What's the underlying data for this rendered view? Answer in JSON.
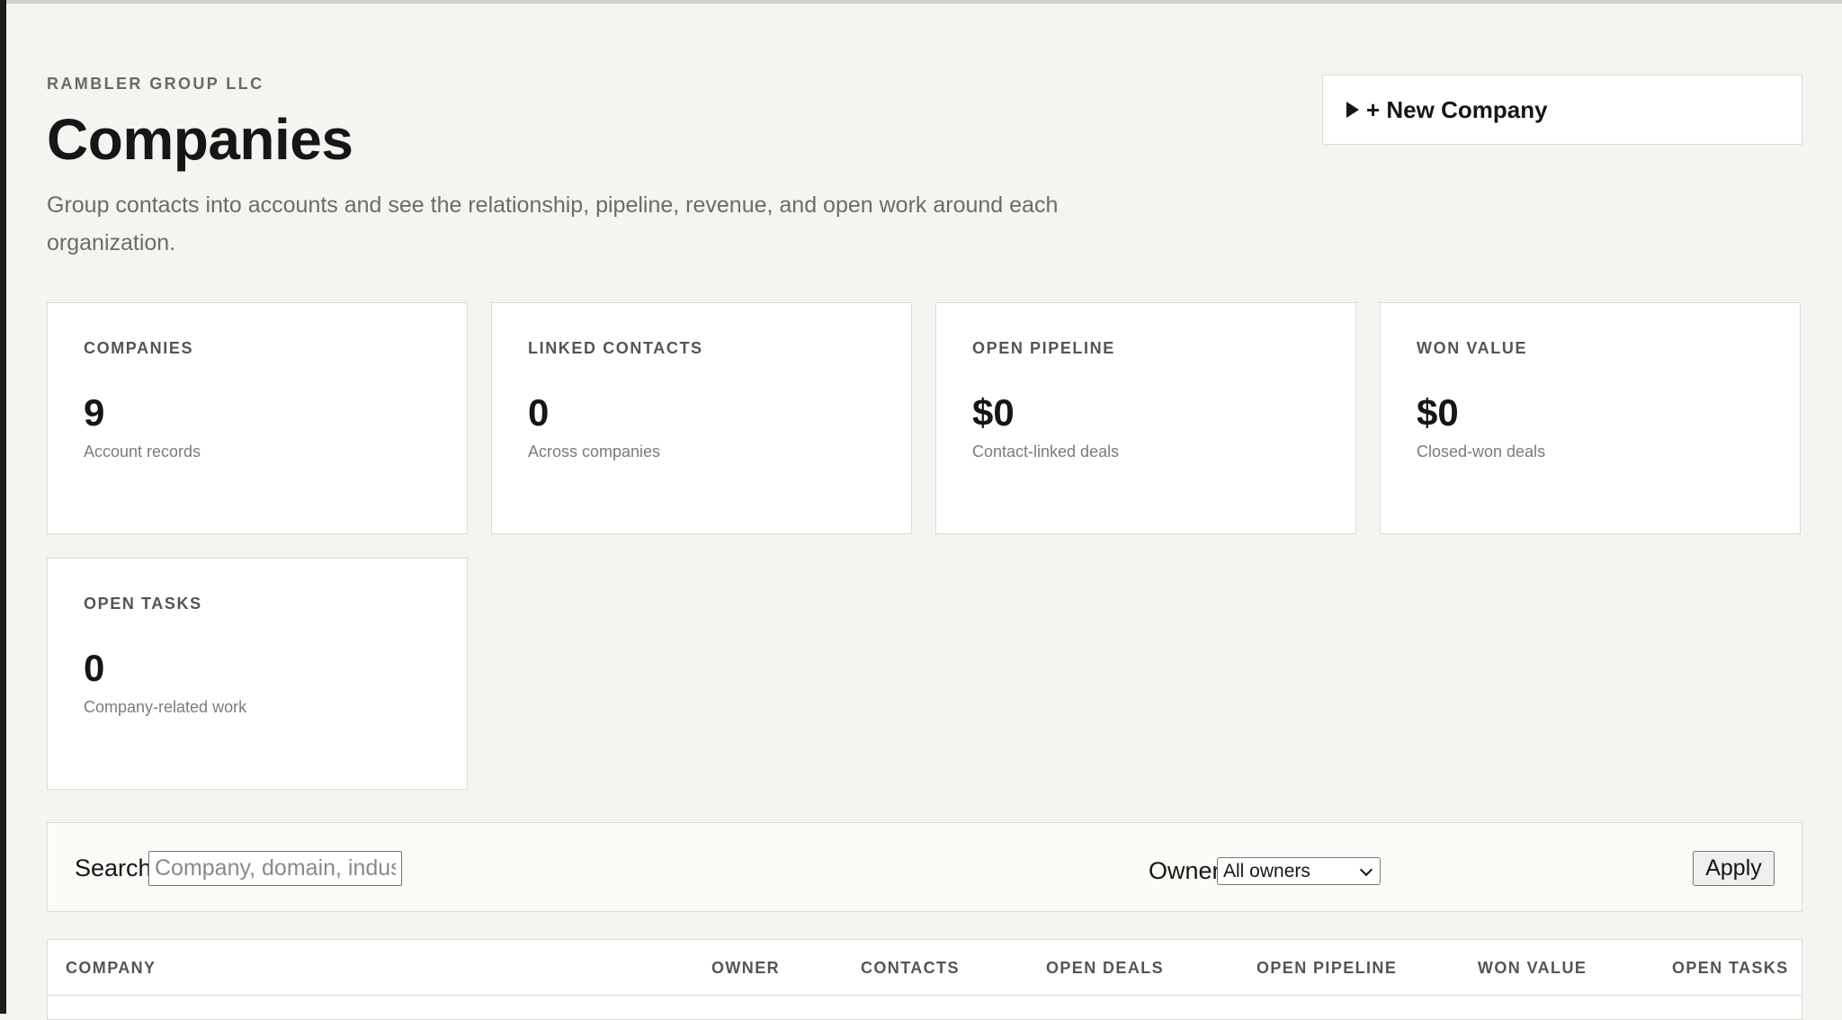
{
  "header": {
    "org": "RAMBLER GROUP LLC",
    "title": "Companies",
    "description": "Group contacts into accounts and see the relationship, pipeline, revenue, and open work around each organization.",
    "new_company_label": "+ New Company"
  },
  "stats": [
    {
      "label": "COMPANIES",
      "value": "9",
      "sub": "Account records"
    },
    {
      "label": "LINKED CONTACTS",
      "value": "0",
      "sub": "Across companies"
    },
    {
      "label": "OPEN PIPELINE",
      "value": "$0",
      "sub": "Contact-linked deals"
    },
    {
      "label": "WON VALUE",
      "value": "$0",
      "sub": "Closed-won deals"
    },
    {
      "label": "OPEN TASKS",
      "value": "0",
      "sub": "Company-related work"
    }
  ],
  "filter": {
    "search_label": "Search",
    "search_placeholder": "Company, domain, industry",
    "owner_label": "Owner",
    "owner_selected": "All owners",
    "apply_label": "Apply"
  },
  "table": {
    "columns": [
      "COMPANY",
      "OWNER",
      "CONTACTS",
      "OPEN DEALS",
      "OPEN PIPELINE",
      "WON VALUE",
      "OPEN TASKS"
    ]
  }
}
